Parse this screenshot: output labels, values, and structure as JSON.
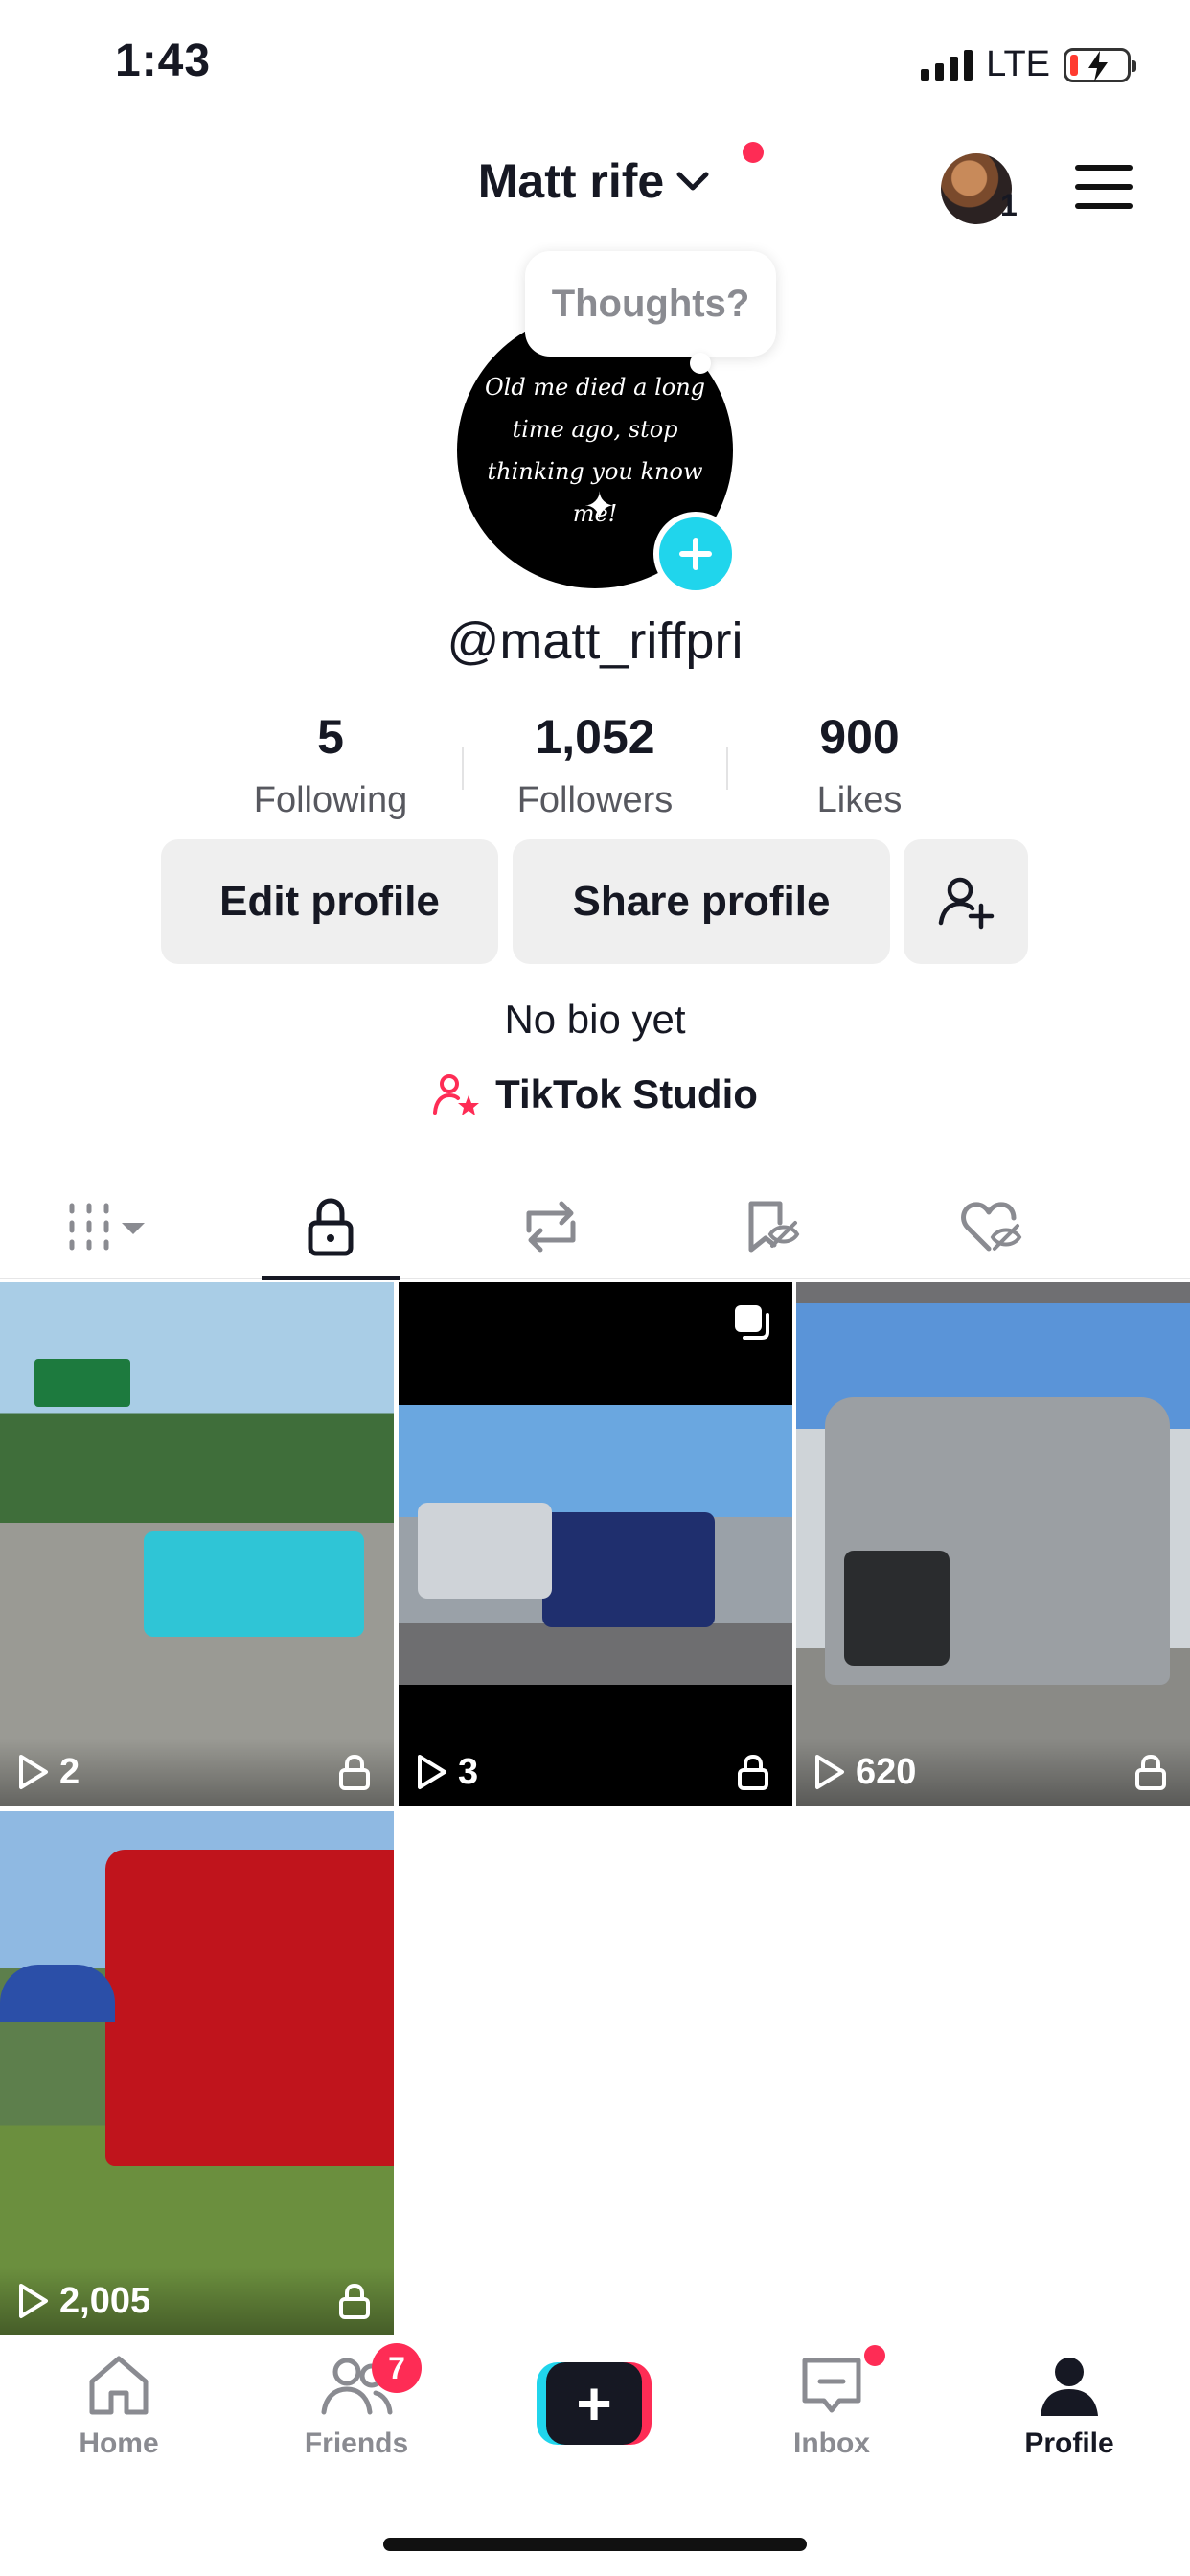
{
  "status_bar": {
    "time": "1:43",
    "network": "LTE"
  },
  "header": {
    "profile_name": "Matt rife",
    "account_count": "1"
  },
  "thoughts_bubble": {
    "placeholder": "Thoughts?"
  },
  "avatar_text": "Old me died a long time ago, stop thinking you know me!",
  "handle": "@matt_riffpri",
  "stats": [
    {
      "value": "5",
      "label": "Following"
    },
    {
      "value": "1,052",
      "label": "Followers"
    },
    {
      "value": "900",
      "label": "Likes"
    }
  ],
  "buttons": {
    "edit": "Edit profile",
    "share": "Share profile"
  },
  "bio": "No bio yet",
  "studio": "TikTok Studio",
  "videos": [
    {
      "views": "2",
      "locked": true
    },
    {
      "views": "3",
      "locked": true
    },
    {
      "views": "620",
      "locked": true
    },
    {
      "views": "2,005",
      "locked": true
    }
  ],
  "bottom_nav": {
    "home": "Home",
    "friends": "Friends",
    "friends_badge": "7",
    "create": "+",
    "inbox": "Inbox",
    "profile": "Profile"
  },
  "colors": {
    "accent_red": "#fe2c55",
    "accent_cyan": "#20d5ec",
    "text": "#161823"
  }
}
